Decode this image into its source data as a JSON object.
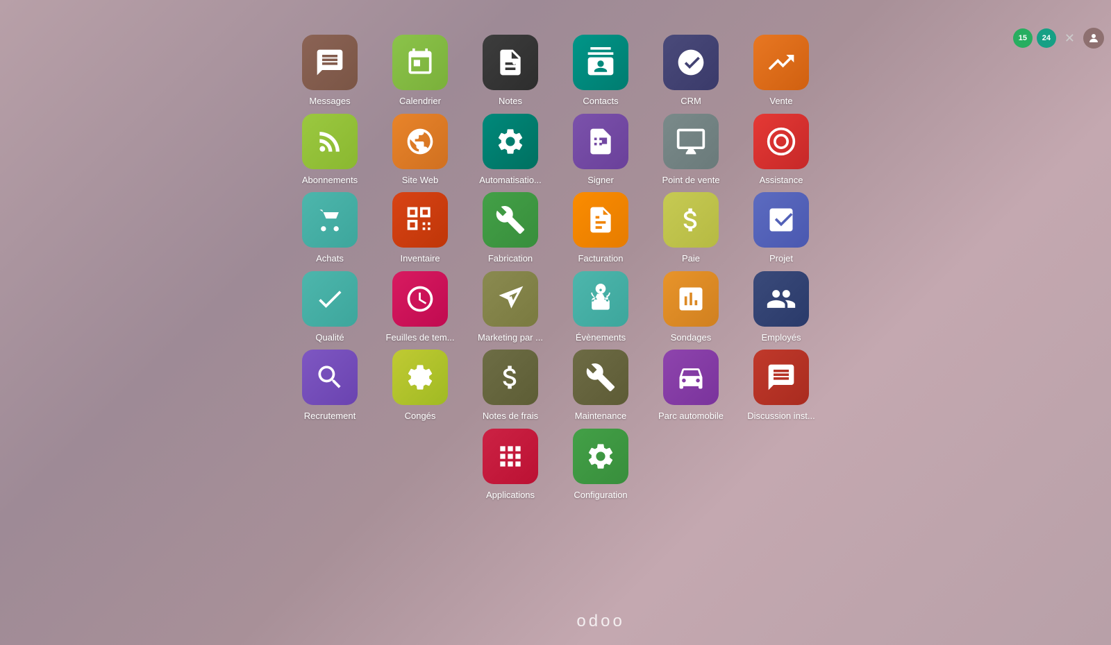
{
  "topbar": {
    "badge1": "15",
    "badge2": "24",
    "close_label": "✕"
  },
  "logo": "odoo",
  "apps": [
    [
      {
        "id": "messages",
        "label": "Messages",
        "color": "ic-brown",
        "icon": "chat"
      },
      {
        "id": "calendrier",
        "label": "Calendrier",
        "color": "ic-green-yellow",
        "icon": "calendar"
      },
      {
        "id": "notes",
        "label": "Notes",
        "color": "ic-dark",
        "icon": "notes"
      },
      {
        "id": "contacts",
        "label": "Contacts",
        "color": "ic-teal",
        "icon": "contacts"
      },
      {
        "id": "crm",
        "label": "CRM",
        "color": "ic-navy",
        "icon": "crm"
      },
      {
        "id": "vente",
        "label": "Vente",
        "color": "ic-orange",
        "icon": "vente"
      }
    ],
    [
      {
        "id": "abonnements",
        "label": "Abonnements",
        "color": "ic-yellow-green",
        "icon": "abonnements"
      },
      {
        "id": "site-web",
        "label": "Site Web",
        "color": "ic-orange2",
        "icon": "web"
      },
      {
        "id": "automatisation",
        "label": "Automatisatio...",
        "color": "ic-teal2",
        "icon": "automation"
      },
      {
        "id": "signer",
        "label": "Signer",
        "color": "ic-purple",
        "icon": "signer"
      },
      {
        "id": "point-de-vente",
        "label": "Point de vente",
        "color": "ic-gray",
        "icon": "pos"
      },
      {
        "id": "assistance",
        "label": "Assistance",
        "color": "ic-red",
        "icon": "assistance"
      }
    ],
    [
      {
        "id": "achats",
        "label": "Achats",
        "color": "ic-teal3",
        "icon": "achats"
      },
      {
        "id": "inventaire",
        "label": "Inventaire",
        "color": "ic-red2",
        "icon": "inventaire"
      },
      {
        "id": "fabrication",
        "label": "Fabrication",
        "color": "ic-dkgreen",
        "icon": "fabrication"
      },
      {
        "id": "facturation",
        "label": "Facturation",
        "color": "ic-orange3",
        "icon": "facturation"
      },
      {
        "id": "paie",
        "label": "Paie",
        "color": "ic-yellow2",
        "icon": "paie"
      },
      {
        "id": "projet",
        "label": "Projet",
        "color": "ic-indigo",
        "icon": "projet"
      }
    ],
    [
      {
        "id": "qualite",
        "label": "Qualité",
        "color": "ic-teal4",
        "icon": "qualite"
      },
      {
        "id": "feuilles-de-temps",
        "label": "Feuilles de tem...",
        "color": "ic-pink",
        "icon": "time"
      },
      {
        "id": "marketing",
        "label": "Marketing par ...",
        "color": "ic-olive",
        "icon": "marketing"
      },
      {
        "id": "evenements",
        "label": "Évènements",
        "color": "ic-teal5",
        "icon": "events"
      },
      {
        "id": "sondages",
        "label": "Sondages",
        "color": "ic-orange4",
        "icon": "sondages"
      },
      {
        "id": "employes",
        "label": "Employés",
        "color": "ic-navy2",
        "icon": "employees"
      }
    ],
    [
      {
        "id": "recrutement",
        "label": "Recrutement",
        "color": "ic-purple2",
        "icon": "recrutement"
      },
      {
        "id": "conges",
        "label": "Congés",
        "color": "ic-yellow3",
        "icon": "conges"
      },
      {
        "id": "notes-de-frais",
        "label": "Notes de frais",
        "color": "ic-olive3",
        "icon": "expenses"
      },
      {
        "id": "maintenance",
        "label": "Maintenance",
        "color": "ic-olive4",
        "icon": "maintenance"
      },
      {
        "id": "parc-automobile",
        "label": "Parc automobile",
        "color": "ic-purple3",
        "icon": "fleet"
      },
      {
        "id": "discussion",
        "label": "Discussion inst...",
        "color": "ic-crimson",
        "icon": "discuss"
      }
    ],
    [
      {
        "id": "applications",
        "label": "Applications",
        "color": "ic-red3",
        "icon": "apps"
      },
      {
        "id": "configuration",
        "label": "Configuration",
        "color": "ic-dkgreen",
        "icon": "config"
      }
    ]
  ]
}
